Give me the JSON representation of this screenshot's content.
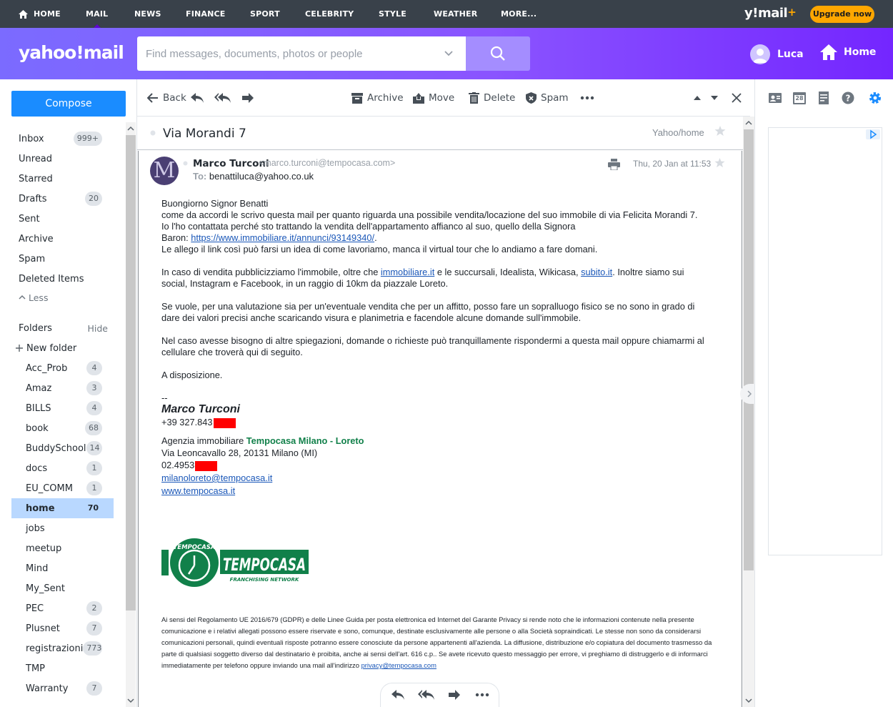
{
  "topnav": {
    "items": [
      "Home",
      "Mail",
      "News",
      "Finance",
      "Sport",
      "Celebrity",
      "Style",
      "Weather",
      "More..."
    ],
    "brand": "y!mail",
    "brand_plus": "+",
    "upgrade": "Upgrade now"
  },
  "header": {
    "logo": "yahoo!mail",
    "search_placeholder": "Find messages, documents, photos or people",
    "user": "Luca",
    "home": "Home"
  },
  "sidebar": {
    "compose": "Compose",
    "system": [
      {
        "label": "Inbox",
        "count": "999+"
      },
      {
        "label": "Unread",
        "count": ""
      },
      {
        "label": "Starred",
        "count": ""
      },
      {
        "label": "Drafts",
        "count": "20"
      },
      {
        "label": "Sent",
        "count": ""
      },
      {
        "label": "Archive",
        "count": ""
      },
      {
        "label": "Spam",
        "count": ""
      },
      {
        "label": "Deleted Items",
        "count": ""
      }
    ],
    "less": "Less",
    "folders_heading": "Folders",
    "hide": "Hide",
    "new_folder": "New folder",
    "folders": [
      {
        "label": "Acc_Prob",
        "count": "4"
      },
      {
        "label": "Amaz",
        "count": "3"
      },
      {
        "label": "BILLS",
        "count": "4"
      },
      {
        "label": "book",
        "count": "68"
      },
      {
        "label": "BuddySchool",
        "count": "14"
      },
      {
        "label": "docs",
        "count": "1"
      },
      {
        "label": "EU_COMM",
        "count": "1"
      },
      {
        "label": "home",
        "count": "70"
      },
      {
        "label": "jobs",
        "count": ""
      },
      {
        "label": "meetup",
        "count": ""
      },
      {
        "label": "Mind",
        "count": ""
      },
      {
        "label": "My_Sent",
        "count": ""
      },
      {
        "label": "PEC",
        "count": "2"
      },
      {
        "label": "Plusnet",
        "count": "7"
      },
      {
        "label": "registrazioni",
        "count": "773"
      },
      {
        "label": "TMP",
        "count": ""
      },
      {
        "label": "Warranty",
        "count": "7"
      }
    ]
  },
  "toolbar": {
    "back": "Back",
    "archive": "Archive",
    "move": "Move",
    "delete": "Delete",
    "spam": "Spam"
  },
  "message": {
    "subject": "Via Morandi 7",
    "folder": "Yahoo/home",
    "avatar_letter": "M",
    "sender_name": "Marco Turconi",
    "sender_email": "<marco.turconi@tempocasa.com>",
    "to_label": "To:",
    "to_value": "benattiluca@yahoo.co.uk",
    "date": "Thu, 20 Jan at 11:53",
    "greeting": "Buongiorno Signor Benatti",
    "p1_l1": "come da accordi le scrivo questa mail per quanto riguarda una possibile vendita/locazione del suo immobile di via Felicita Morandi 7.",
    "p1_l2": "Io l'ho contattata perché sto trattando la vendita dell'appartamento affianco al suo, quello della Signora",
    "p1_l3_pre": "Baron: ",
    "p1_link": "https://www.immobiliare.it/annunci/93149340/",
    "p1_l3_post": ".",
    "p1_l4": "Le allego il link così può farsi un idea di come lavoriamo, manca il virtual tour che lo andiamo a fare domani.",
    "p2_pre": "In caso di vendita pubblicizziamo l'immobile, oltre che ",
    "p2_link1": "immobiliare.it",
    "p2_mid": " e le succursali, Idealista, Wikicasa, ",
    "p2_link2": "subito.it",
    "p2_post": ". Inoltre siamo sui",
    "p2_l2": "social, Instagram e Facebook, in un raggio di 10km da piazzale Loreto.",
    "p3_l1": "Se vuole, per una valutazione sia per un'eventuale vendita che per un affitto, posso fare un sopralluogo fisico se no sono in grado di",
    "p3_l2": "dare dei valori precisi anche scaricando visura e planimetria e facendole alcune domande sull'immobile.",
    "p4_l1": "Nel caso avesse bisogno di altre spiegazioni, domande o richieste può tranquillamente rispondermi a questa mail oppure chiamarmi al",
    "p4_l2": "cellulare che troverà qui di seguito.",
    "closing": "A disposizione.",
    "dashes": "--",
    "sig_name": "Marco Turconi",
    "sig_phone": "+39 327.843",
    "agency_pre": "Agenzia immobiliare ",
    "agency_brand": "Tempocasa Milano - Loreto",
    "address": "Via Leoncavallo 28, 20131 Milano (MI)",
    "office_phone": "02.4953",
    "sig_email": "milanoloreto@tempocasa.it",
    "sig_web": "www.tempocasa.it",
    "logo_top": "TEMPOCASA",
    "logo_word": "TEMPOCASA",
    "logo_sub": "FRANCHISING NETWORK",
    "disclaimer": "Ai sensi del Regolamento UE 2016/679 (GDPR) e delle Linee Guida per posta elettronica ed Internet del Garante Privacy si rende noto che le informazioni contenute nella presente comunicazione e i relativi allegati possono essere riservate e sono, comunque, destinate esclusivamente alle persone o alla Società sopraindicati. Le stesse non sono da considerarsi comunicazioni personali, quindi eventuali risposte potranno essere conosciute da persone appartenenti all'azienda. La diffusione, distribuzione e/o copiatura del documento trasmesso da parte di qualsiasi soggetto diverso dal destinatario è proibita, anche ai sensi dell'art. 616 c.p.. Se avete ricevuto questo messaggio per errore, vi preghiamo di distruggerlo e di informarci immediatamente per telefono oppure inviando una mail all'indirizzo ",
    "disclaimer_link": "privacy@tempocasa.com"
  },
  "right_panel": {
    "calendar_day": "28"
  },
  "colors": {
    "accent": "#1a8cff",
    "header_gradient_start": "#7b6bff",
    "header_gradient_end": "#7426ff",
    "active_folder": "#b9d8ff",
    "brand_green": "#11804a",
    "redaction": "#ff0000",
    "upgrade": "#ffa700"
  }
}
